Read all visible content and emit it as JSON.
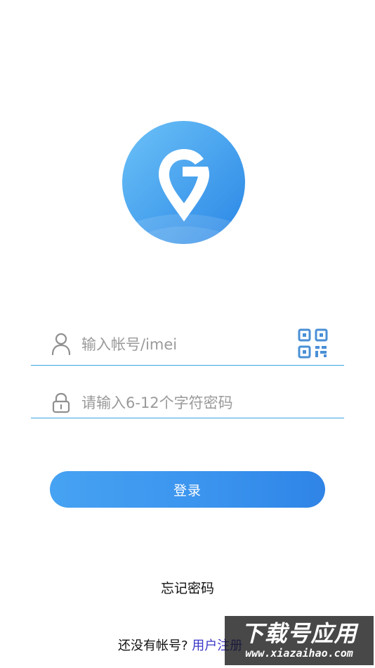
{
  "login": {
    "account_placeholder": "输入帐号/imei",
    "password_placeholder": "请输入6-12个字符密码",
    "login_button": "登录",
    "forgot_password": "忘记密码",
    "register_prompt": "还没有帐号?",
    "register_link": "用户注册"
  },
  "watermark": {
    "title": "下载号应用",
    "url": "www.xiazaihao.com"
  },
  "icons": {
    "logo": "location-g-logo",
    "account": "user-icon",
    "password": "lock-icon",
    "scan": "qr-code-icon"
  },
  "colors": {
    "accent": "#3a93ee",
    "underline": "#38a6e6",
    "link": "#3a36c8",
    "logo_light": "#6cc2f7",
    "logo_dark": "#2a86e6"
  }
}
